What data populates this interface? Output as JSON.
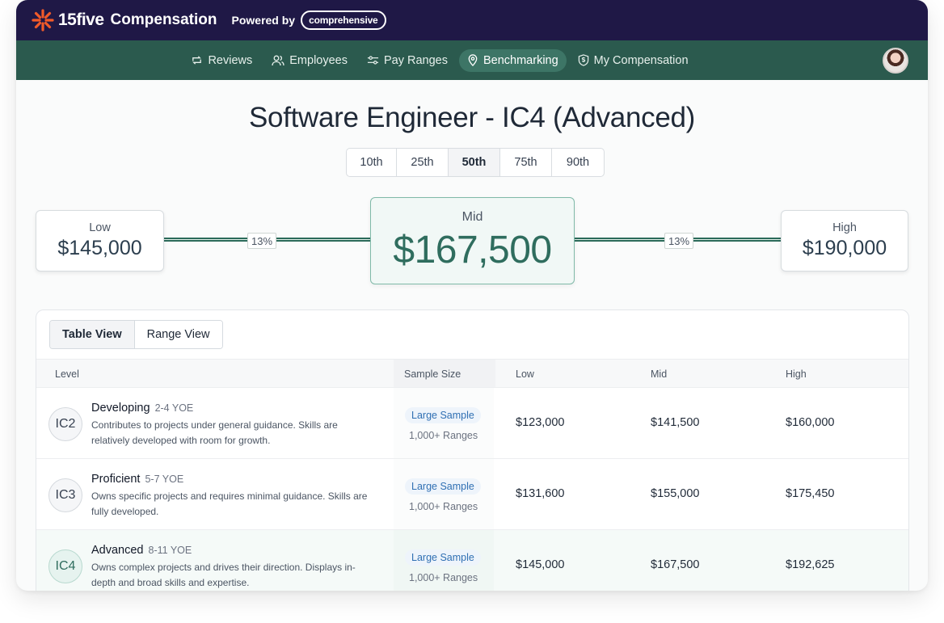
{
  "brand": {
    "logo_text": "15five",
    "app_name": "Compensation",
    "powered_by": "Powered by",
    "partner": "comprehensive"
  },
  "nav": {
    "items": [
      {
        "label": "Reviews",
        "icon": "loop-icon",
        "active": false
      },
      {
        "label": "Employees",
        "icon": "people-icon",
        "active": false
      },
      {
        "label": "Pay Ranges",
        "icon": "sliders-icon",
        "active": false
      },
      {
        "label": "Benchmarking",
        "icon": "location-pin-icon",
        "active": true
      },
      {
        "label": "My Compensation",
        "icon": "shield-dollar-icon",
        "active": false
      }
    ]
  },
  "page": {
    "title": "Software Engineer - IC4 (Advanced)"
  },
  "percentiles": {
    "options": [
      "10th",
      "25th",
      "50th",
      "75th",
      "90th"
    ],
    "selected": "50th"
  },
  "range": {
    "low_label": "Low",
    "low_value": "$145,000",
    "mid_label": "Mid",
    "mid_value": "$167,500",
    "high_label": "High",
    "high_value": "$190,000",
    "low_to_mid_pct": "13%",
    "mid_to_high_pct": "13%"
  },
  "views": {
    "options": [
      "Table View",
      "Range View"
    ],
    "selected": "Table View"
  },
  "table": {
    "headers": {
      "level": "Level",
      "sample": "Sample Size",
      "low": "Low",
      "mid": "Mid",
      "high": "High"
    },
    "rows": [
      {
        "badge": "IC2",
        "name": "Developing",
        "yoe": "2-4 YOE",
        "desc": "Contributes to projects under general guidance. Skills are relatively developed with room for growth.",
        "sample": "Large Sample",
        "sample_sub": "1,000+ Ranges",
        "low": "$123,000",
        "mid": "$141,500",
        "high": "$160,000"
      },
      {
        "badge": "IC3",
        "name": "Proficient",
        "yoe": "5-7 YOE",
        "desc": "Owns specific projects and requires minimal guidance. Skills are fully developed.",
        "sample": "Large Sample",
        "sample_sub": "1,000+ Ranges",
        "low": "$131,600",
        "mid": "$155,000",
        "high": "$175,450"
      },
      {
        "badge": "IC4",
        "name": "Advanced",
        "yoe": "8-11 YOE",
        "desc": "Owns complex projects and drives their direction. Displays in-depth and broad skills and expertise.",
        "sample": "Large Sample",
        "sample_sub": "1,000+ Ranges",
        "low": "$145,000",
        "mid": "$167,500",
        "high": "$192,625"
      }
    ]
  },
  "colors": {
    "header_bg": "#1f1846",
    "nav_bg": "#2b5a4e",
    "accent": "#2f6d5e",
    "sample_pill": "#2f6fb3"
  }
}
